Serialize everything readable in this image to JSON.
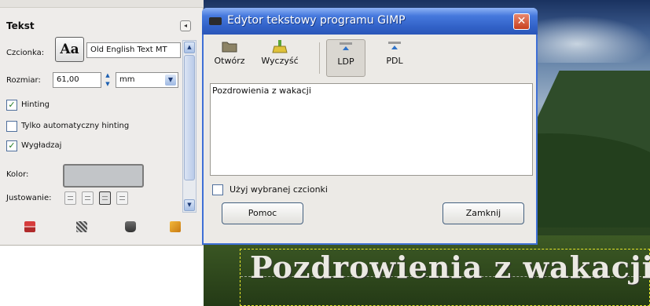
{
  "text_tool_panel": {
    "title": "Tekst",
    "font_label": "Czcionka:",
    "font_preview": "Aa",
    "font_value": "Old English Text MT",
    "size_label": "Rozmiar:",
    "size_value": "61,00",
    "unit_value": "mm",
    "hinting_label": "Hinting",
    "hinting_checked": true,
    "auto_hinting_label": "Tylko automatyczny hinting",
    "auto_hinting_checked": false,
    "antialias_label": "Wygładzaj",
    "antialias_checked": true,
    "color_label": "Kolor:",
    "color_value": "#c2c5c8",
    "justify_label": "Justowanie:",
    "justify_options": [
      "left-justify-icon",
      "right-justify-icon",
      "center-justify-icon",
      "fill-justify-icon"
    ],
    "justify_active_index": 2,
    "bottom_icons": [
      "save-icon",
      "restore-icon",
      "delete-icon",
      "reset-icon"
    ]
  },
  "dialog": {
    "title": "Edytor tekstowy programu GIMP",
    "toolbar": {
      "open_label": "Otwórz",
      "clear_label": "Wyczyść",
      "ltr_label": "LDP",
      "rtl_label": "PDL",
      "ltr_pressed": true
    },
    "editor_text": "Pozdrowienia z wakacji",
    "use_selected_font_label": "Użyj wybranej czcionki",
    "use_selected_font_checked": false,
    "help_label": "Pomoc",
    "close_label": "Zamknij",
    "close_icon": "close-icon"
  },
  "canvas": {
    "text": "Pozdrowienia z wakacji"
  }
}
